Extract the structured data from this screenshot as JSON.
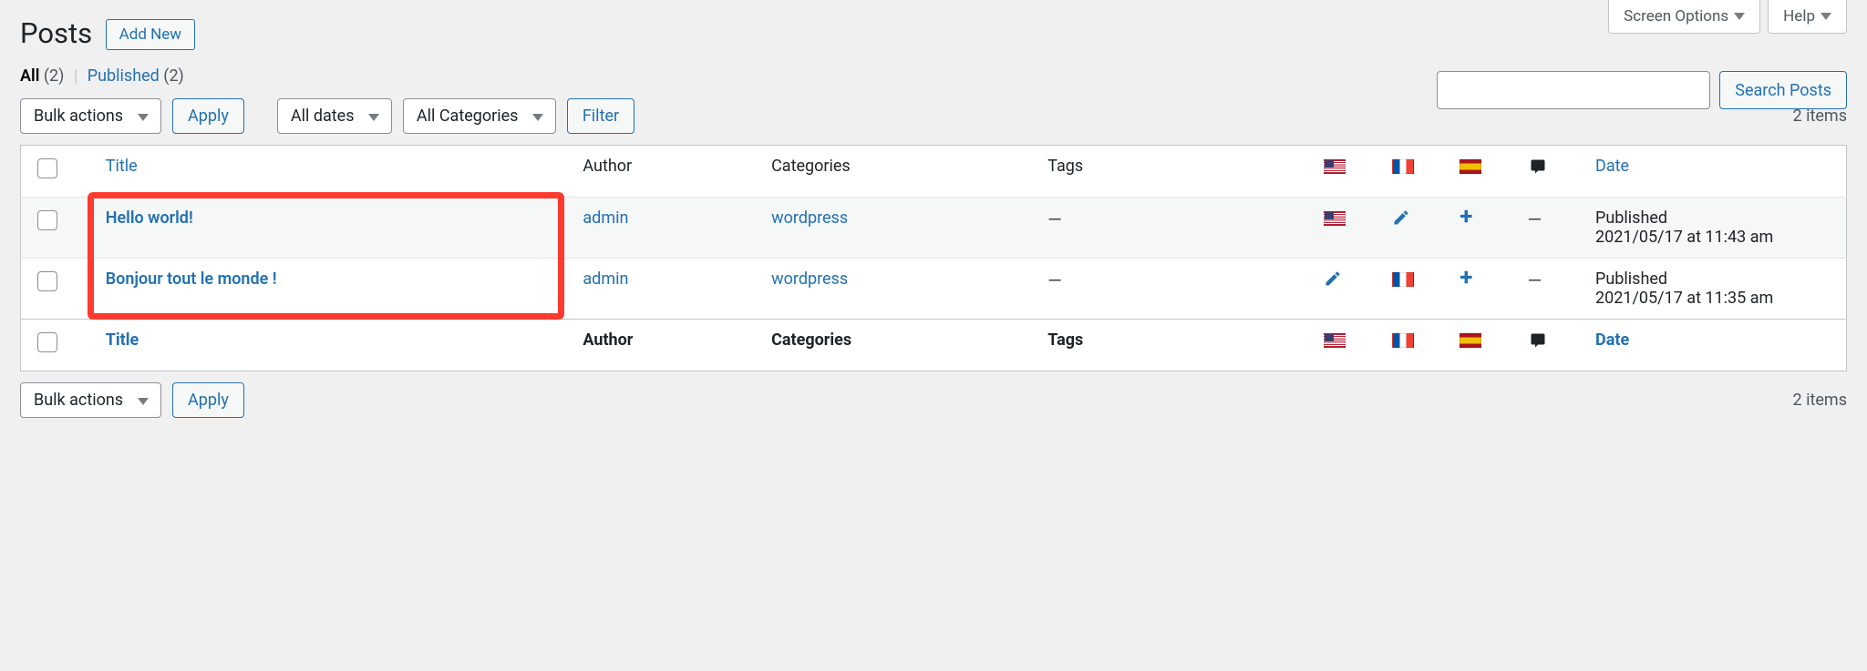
{
  "topbar": {
    "screen_options": "Screen Options",
    "help": "Help"
  },
  "header": {
    "title": "Posts",
    "add_new": "Add New"
  },
  "subsub": {
    "all_label": "All",
    "all_count": "(2)",
    "published_label": "Published",
    "published_count": "(2)"
  },
  "search": {
    "button": "Search Posts",
    "value": ""
  },
  "filters": {
    "bulk_actions": "Bulk actions",
    "apply": "Apply",
    "dates": "All dates",
    "categories": "All Categories",
    "filter": "Filter"
  },
  "items_count": "2 items",
  "columns": {
    "title": "Title",
    "author": "Author",
    "categories": "Categories",
    "tags": "Tags",
    "date": "Date"
  },
  "flags": {
    "us": "flag-us",
    "fr": "flag-fr",
    "es": "flag-es"
  },
  "rows": [
    {
      "title": "Hello world!",
      "author": "admin",
      "categories": "wordpress",
      "tags": "—",
      "lang_current": "us",
      "lang_edit": "fr",
      "lang_add": "es",
      "lang_dash": "—",
      "date_status": "Published",
      "date_value": "2021/05/17 at 11:43 am"
    },
    {
      "title": "Bonjour tout le monde !",
      "author": "admin",
      "categories": "wordpress",
      "tags": "—",
      "lang_current": "fr",
      "lang_edit": "us",
      "lang_add": "es",
      "lang_dash": "—",
      "date_status": "Published",
      "date_value": "2021/05/17 at 11:35 am"
    }
  ],
  "annotation": {
    "highlight": "titles-column"
  }
}
